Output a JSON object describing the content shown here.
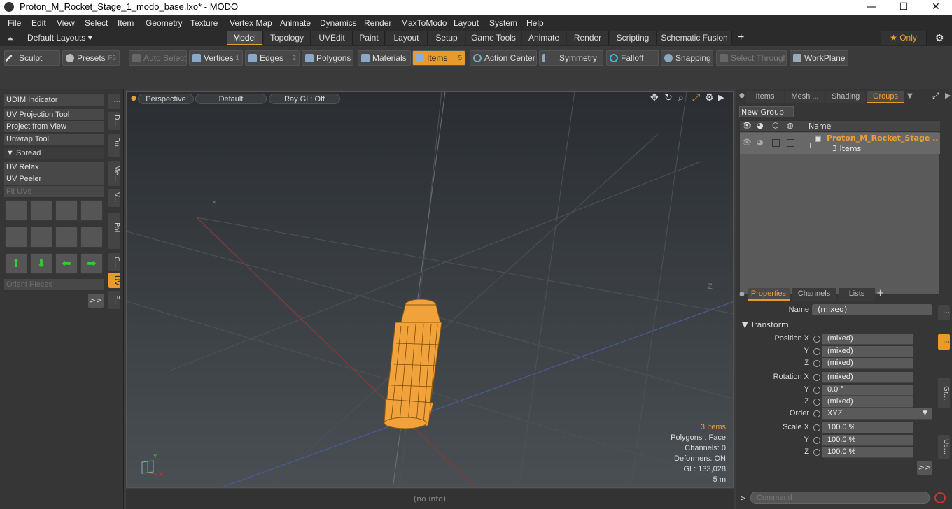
{
  "title": "Proton_M_Rocket_Stage_1_modo_base.lxo* - MODO",
  "window_controls": {
    "minimize": "—",
    "maximize": "☐",
    "close": "✕"
  },
  "menu": [
    "File",
    "Edit",
    "View",
    "Select",
    "Item",
    "Geometry",
    "Texture",
    "Vertex Map",
    "Animate",
    "Dynamics",
    "Render",
    "MaxToModo",
    "Layout",
    "System",
    "Help"
  ],
  "layout_selector": "Default Layouts ▾",
  "layout_tabs": [
    "Model",
    "Topology",
    "UVEdit",
    "Paint",
    "Layout",
    "Setup",
    "Game Tools",
    "Animate",
    "Render",
    "Scripting",
    "Schematic Fusion"
  ],
  "layout_add": "+",
  "only_label": "★ Only",
  "toolbar": {
    "sculpt": "Sculpt",
    "presets": "Presets",
    "presets_key": "F6",
    "auto_select": "Auto Select",
    "vertices": "Vertices",
    "vertices_key": "1",
    "edges": "Edges",
    "edges_key": "2",
    "polygons": "Polygons",
    "materials": "Materials",
    "items": "Items",
    "items_key": "5",
    "action_center": "Action Center",
    "symmetry": "Symmetry",
    "falloff": "Falloff",
    "snapping": "Snapping",
    "select_through": "Select Through",
    "workplane": "WorkPlane"
  },
  "left_panel": {
    "udim": "UDIM Indicator",
    "uv_projection": "UV Projection Tool",
    "project_from_view": "Project from View",
    "unwrap": "Unwrap Tool",
    "spread": "▼ Spread",
    "uv_relax": "UV Relax",
    "uv_peeler": "UV Peeler",
    "fit_uvs": "Fit UVs",
    "orient_pieces": "Orient Pieces",
    "more": ">>",
    "side_tabs": [
      "D...",
      "Du...",
      "Me...",
      "V...",
      "Pol...",
      "C...",
      "UV",
      "F..."
    ]
  },
  "viewport": {
    "view": "Perspective",
    "shading": "Default",
    "raygl": "Ray GL: Off",
    "items_count": "3 Items",
    "polygons": "Polygons : Face",
    "channels": "Channels: 0",
    "deformers": "Deformers: ON",
    "gl": "GL: 133,028",
    "scale": "5 m",
    "axis_y": "Y",
    "axis_x": "X",
    "axis_z": "Z"
  },
  "status": "(no info)",
  "right_panel": {
    "tabs": [
      "Items",
      "Mesh ...",
      "Shading",
      "Groups"
    ],
    "new_group": "New Group",
    "name_col": "Name",
    "group_name": "Proton_M_Rocket_Stage ...",
    "group_count": "3 Items",
    "prop_tabs": [
      "Properties",
      "Channels",
      "Lists"
    ],
    "name_label": "Name",
    "name_value": "(mixed)",
    "transform": "▼ Transform",
    "position_x_label": "Position X",
    "y_label": "Y",
    "z_label": "Z",
    "position_x": "(mixed)",
    "position_y": "(mixed)",
    "position_z": "(mixed)",
    "rotation_x_label": "Rotation X",
    "rotation_x": "(mixed)",
    "rotation_y": "0.0 °",
    "rotation_z": "(mixed)",
    "order_label": "Order",
    "order_value": "XYZ",
    "scale_x_label": "Scale X",
    "scale_x": "100.0 %",
    "scale_y": "100.0 %",
    "scale_z": "100.0 %",
    "more": ">>",
    "side_tabs": [
      "Gr...",
      "Us..."
    ]
  },
  "command": {
    "prompt": ">",
    "placeholder": "Command"
  },
  "colors": {
    "accent": "#e89a2a",
    "mesh": "#f2a23a"
  }
}
